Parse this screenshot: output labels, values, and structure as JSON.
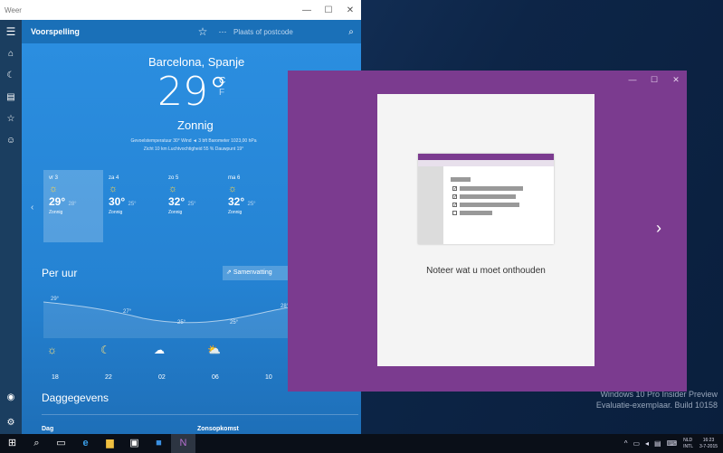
{
  "weather": {
    "app_title": "Weer",
    "window_controls": {
      "minimize": "—",
      "maximize": "☐",
      "close": "✕"
    },
    "header": {
      "title": "Voorspelling",
      "search_placeholder": "Plaats of postcode"
    },
    "city": "Barcelona, Spanje",
    "temperature": "29",
    "unit_c": "C",
    "unit_f": "F",
    "condition": "Zonnig",
    "details_line1": "Gevoelstemperatuur 30°   Wind ◄ 3 bft   Barometer 1023,00 hPa",
    "details_line2": "Zicht 10 km   Luchtvochtigheid 55 %   Dauwpunt 19°",
    "days": [
      {
        "name": "vr 3",
        "high": "29°",
        "low": "28°",
        "cond": "Zonnig"
      },
      {
        "name": "za 4",
        "high": "30°",
        "low": "25°",
        "cond": "Zonnig"
      },
      {
        "name": "zo 5",
        "high": "32°",
        "low": "25°",
        "cond": "Zonnig"
      },
      {
        "name": "ma 6",
        "high": "32°",
        "low": "25°",
        "cond": "Zonnig"
      }
    ],
    "per_hour_title": "Per uur",
    "summary_button": "Samenvatting",
    "hourly_temps": [
      "29°",
      "27°",
      "25°",
      "25°",
      "28°"
    ],
    "hourly_times": [
      "18",
      "22",
      "02",
      "06",
      "10"
    ],
    "daily_title": "Daggegevens",
    "daily_col_day": "Dag",
    "daily_col_sunrise": "Zonsopkomst"
  },
  "onenote": {
    "caption": "Noteer wat u moet onthouden",
    "window_controls": {
      "minimize": "—",
      "maximize": "☐",
      "close": "✕"
    }
  },
  "desktop": {
    "watermark_line1": "Windows 10 Pro Insider Preview",
    "watermark_line2": "Evaluatie-exemplaar. Build 10158"
  },
  "taskbar": {
    "language_1": "NLD",
    "language_2": "INTL",
    "time": "16:23",
    "date": "3-7-2015"
  }
}
